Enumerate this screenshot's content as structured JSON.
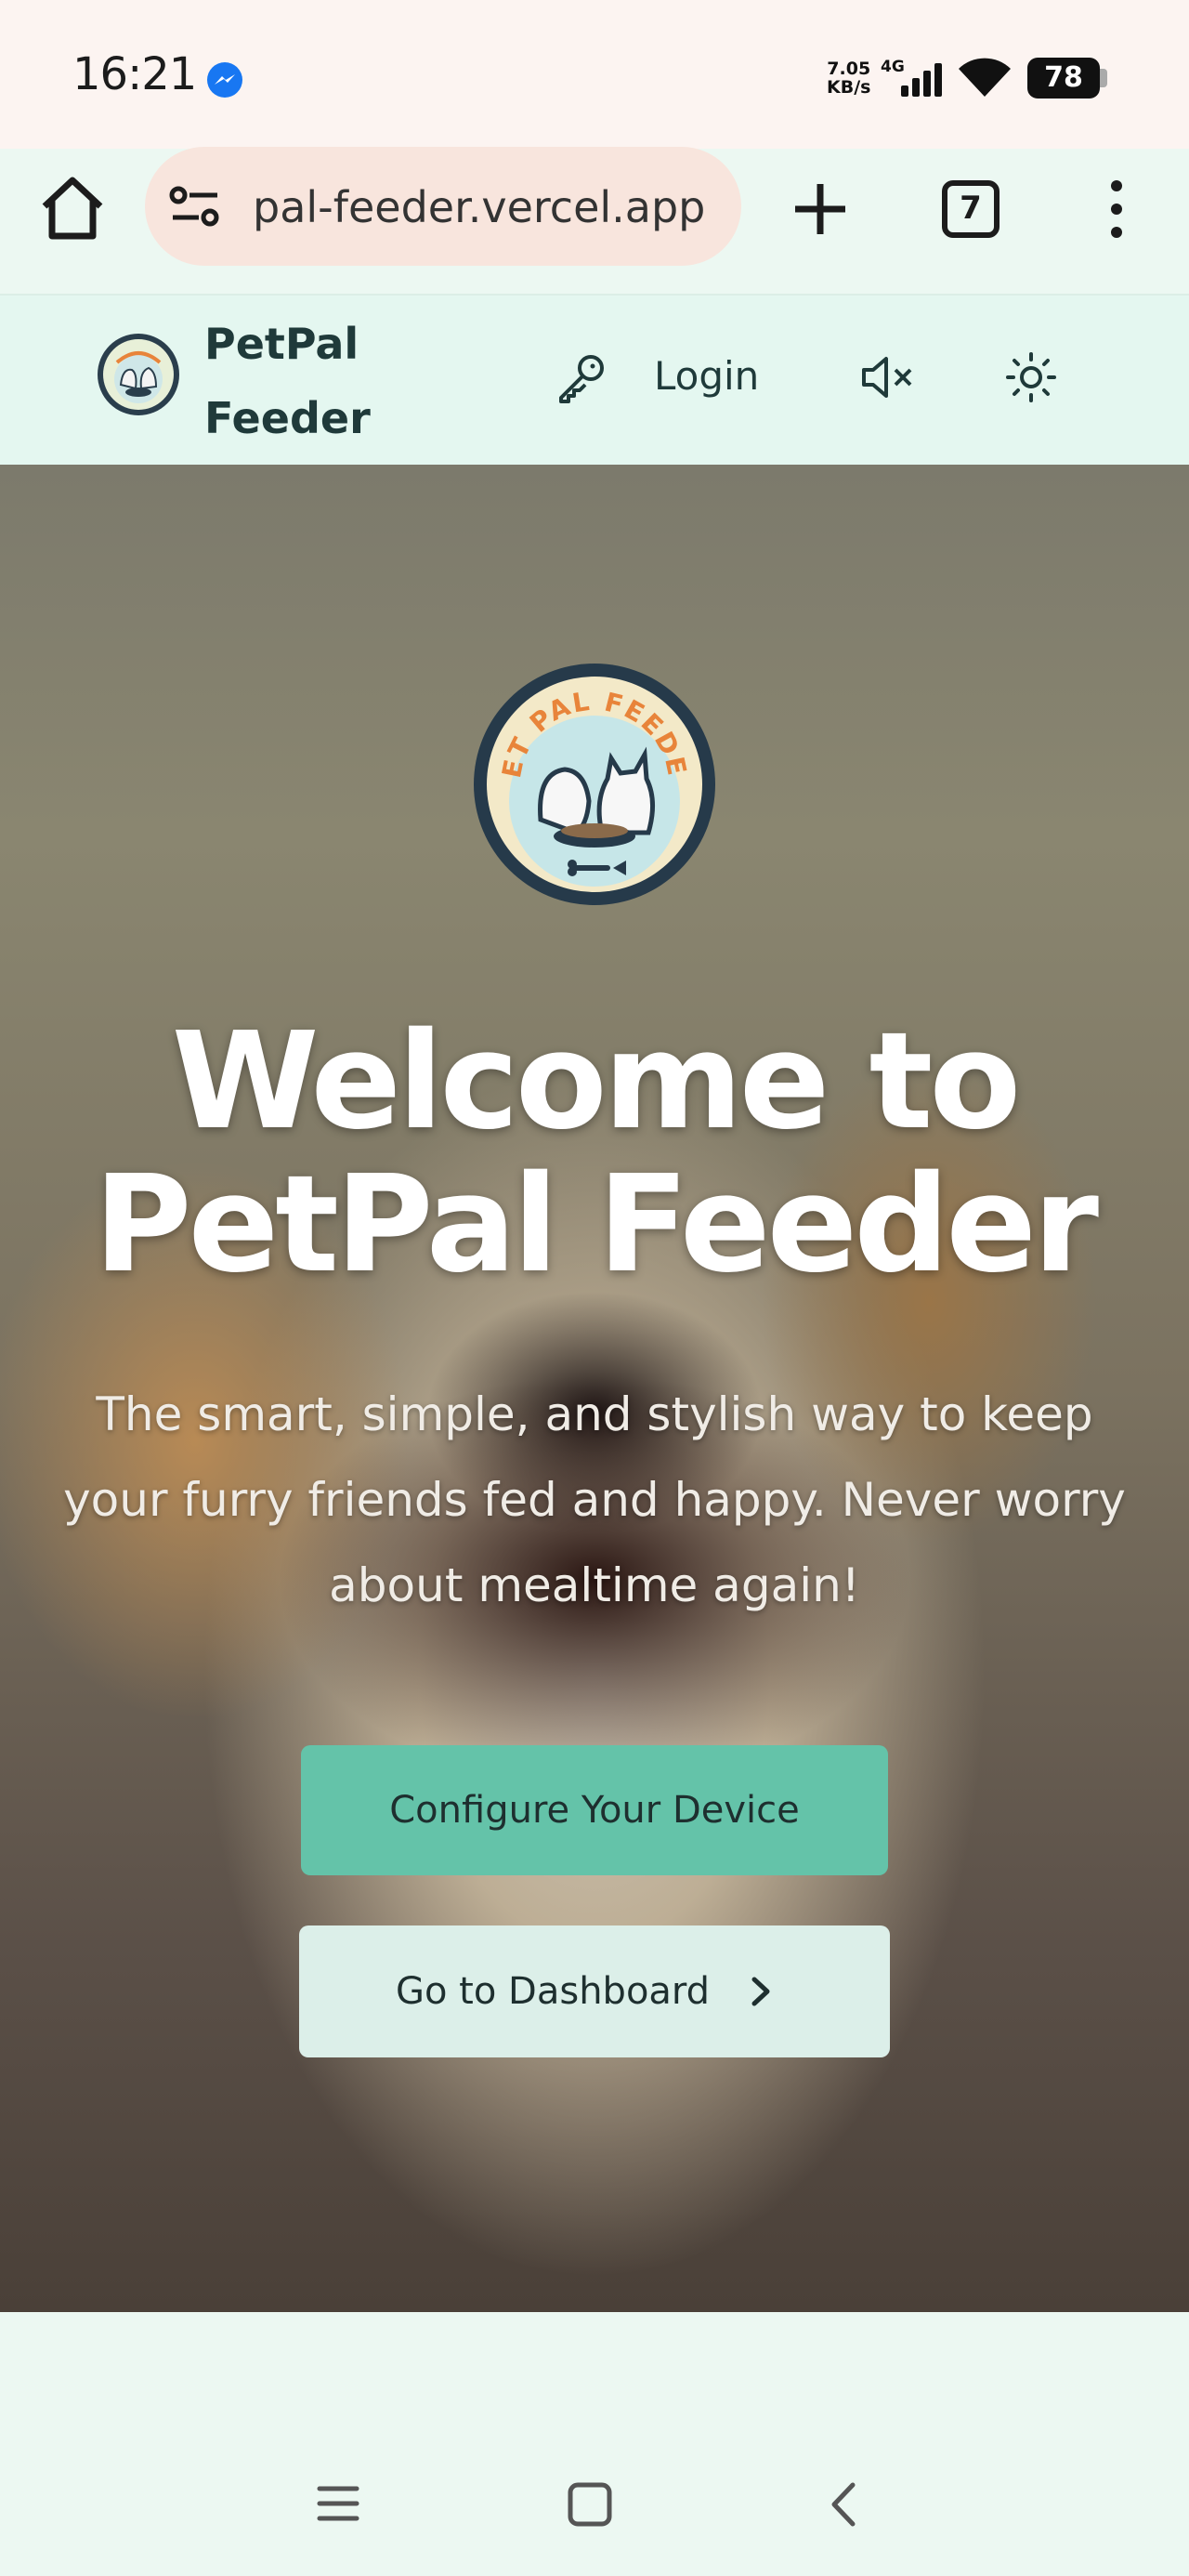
{
  "status_bar": {
    "time": "16:21",
    "net_speed_value": "7.05",
    "net_speed_unit": "KB/s",
    "network_type": "4G",
    "battery": "78"
  },
  "browser": {
    "url": "pal-feeder.vercel.app",
    "tab_count": "7"
  },
  "header": {
    "brand_line1": "PetPal",
    "brand_line2": "Feeder",
    "login_label": "Login"
  },
  "hero": {
    "logo_text": "PET PAL FEEDER",
    "title_line1": "Welcome to",
    "title_line2": "PetPal Feeder",
    "subtitle": "The smart, simple, and stylish way to keep your furry friends fed and happy. Never worry about mealtime again!",
    "configure_label": "Configure Your Device",
    "dashboard_label": "Go to Dashboard"
  },
  "colors": {
    "primary_button": "#64c3a9",
    "secondary_button": "#dcefe9",
    "header_bg": "#e4f7f0",
    "status_bar_bg": "#fcf4f1"
  }
}
